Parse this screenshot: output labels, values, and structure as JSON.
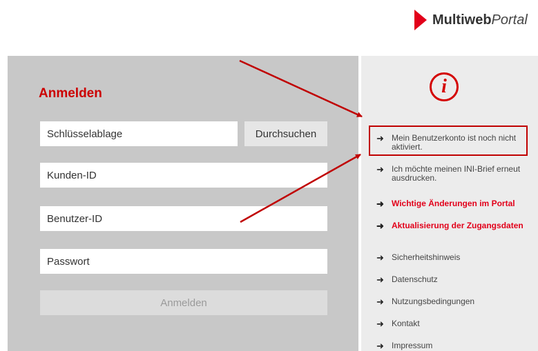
{
  "logo": {
    "brand_bold": "Multiweb",
    "brand_italic": "Portal"
  },
  "login": {
    "title": "Anmelden",
    "keystore_label": "Schlüsselablage",
    "browse_label": "Durchsuchen",
    "customer_id_label": "Kunden-ID",
    "user_id_label": "Benutzer-ID",
    "password_label": "Passwort",
    "submit_label": "Anmelden"
  },
  "info": {
    "icon": "info-icon",
    "links": [
      {
        "label": "Mein Benutzerkonto ist noch nicht aktiviert.",
        "style": "normal"
      },
      {
        "label": "Ich möchte meinen INI-Brief erneut ausdrucken.",
        "style": "normal"
      },
      {
        "label": "Wichtige Änderungen im Portal",
        "style": "red"
      },
      {
        "label": "Aktualisierung der Zugangsdaten",
        "style": "red"
      },
      {
        "label": "Sicherheitshinweis",
        "style": "normal"
      },
      {
        "label": "Datenschutz",
        "style": "normal"
      },
      {
        "label": "Nutzungsbedingungen",
        "style": "normal"
      },
      {
        "label": "Kontakt",
        "style": "normal"
      },
      {
        "label": "Impressum",
        "style": "normal"
      }
    ]
  },
  "colors": {
    "accent_red": "#e2001a",
    "panel_gray": "#c8c8c8",
    "info_bg": "#ececec",
    "annotation": "#c00000"
  }
}
